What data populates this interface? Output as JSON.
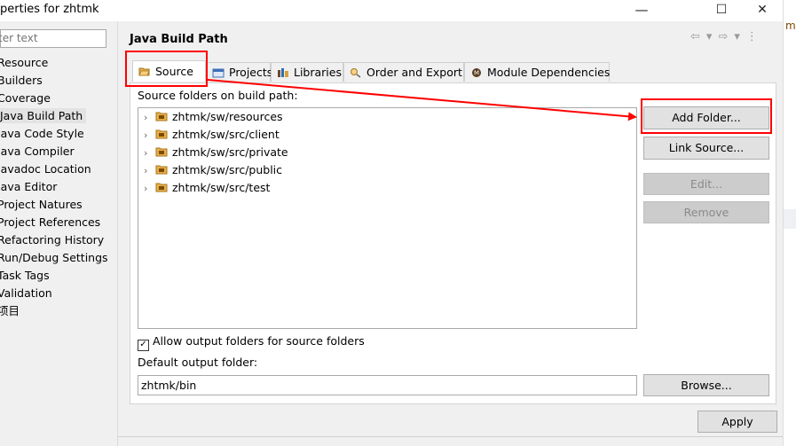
{
  "window": {
    "title": "perties for zhtmk",
    "controls": {
      "minimize": "—",
      "maximize": "☐",
      "close": "✕"
    },
    "right_strip_fragment": "me"
  },
  "filter": {
    "placeholder": "ter text"
  },
  "nav": {
    "items": [
      {
        "label": "Resource",
        "selected": false
      },
      {
        "label": "Builders",
        "selected": false
      },
      {
        "label": "Coverage",
        "selected": false
      },
      {
        "label": "Java Build Path",
        "selected": true
      },
      {
        "label": "Java Code Style",
        "selected": false
      },
      {
        "label": "Java Compiler",
        "selected": false
      },
      {
        "label": "Javadoc Location",
        "selected": false
      },
      {
        "label": "Java Editor",
        "selected": false
      },
      {
        "label": "Project Natures",
        "selected": false
      },
      {
        "label": "Project References",
        "selected": false
      },
      {
        "label": "Refactoring History",
        "selected": false
      },
      {
        "label": "Run/Debug Settings",
        "selected": false
      },
      {
        "label": "Task Tags",
        "selected": false
      },
      {
        "label": "Validation",
        "selected": false
      },
      {
        "label": "项目",
        "selected": false
      }
    ]
  },
  "page": {
    "title": "Java Build Path",
    "nav_glyphs": {
      "back": "⇦",
      "back_menu": "▾",
      "forward": "⇨",
      "forward_menu": "▾",
      "more": "⋮"
    }
  },
  "tabs": [
    {
      "label": "Source",
      "active": true,
      "icon": "source-folder-icon"
    },
    {
      "label": "Projects",
      "active": false,
      "icon": "projects-icon"
    },
    {
      "label": "Libraries",
      "active": false,
      "icon": "libraries-icon"
    },
    {
      "label": "Order and Export",
      "active": false,
      "icon": "order-export-icon"
    },
    {
      "label": "Module Dependencies",
      "active": false,
      "icon": "module-dependencies-icon"
    }
  ],
  "source": {
    "label": "Source folders on build path:",
    "folders": [
      "zhtmk/sw/resources",
      "zhtmk/sw/src/client",
      "zhtmk/sw/src/private",
      "zhtmk/sw/src/public",
      "zhtmk/sw/src/test"
    ]
  },
  "buttons": {
    "add_folder": "Add Folder...",
    "link_source": "Link Source...",
    "edit": "Edit...",
    "remove": "Remove",
    "browse": "Browse...",
    "apply": "Apply"
  },
  "allow_output": {
    "label": "Allow output folders for source folders",
    "checked": true
  },
  "output": {
    "label": "Default output folder:",
    "value": "zhtmk/bin"
  },
  "colors": {
    "annotation": "#ff0000",
    "folder": "#e8b04a",
    "selection": "#e3e3e3"
  }
}
